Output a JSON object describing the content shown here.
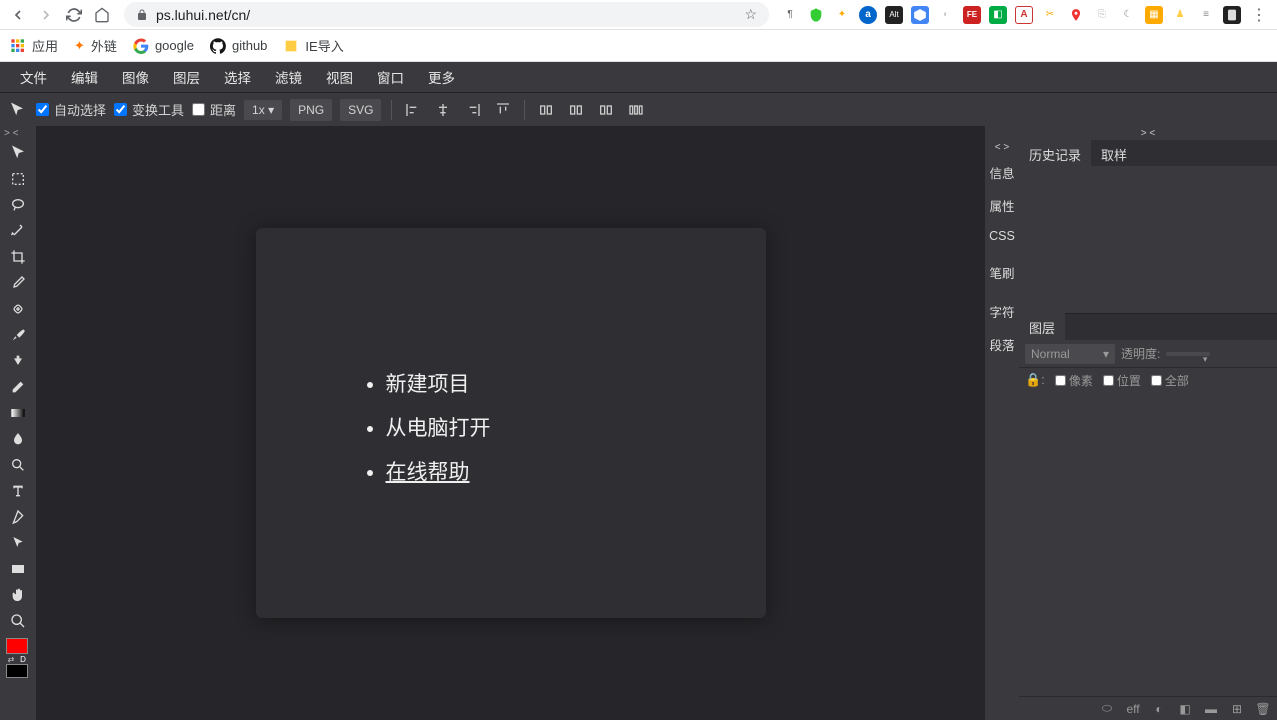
{
  "browser": {
    "url": "ps.luhui.net/cn/",
    "bookmarks": {
      "apps": "应用",
      "external": "外链",
      "google": "google",
      "github": "github",
      "ie_import": "IE导入"
    }
  },
  "menu": {
    "file": "文件",
    "edit": "编辑",
    "image": "图像",
    "layer": "图层",
    "select": "选择",
    "filter": "滤镜",
    "view": "视图",
    "window": "窗口",
    "more": "更多"
  },
  "options": {
    "auto_select": "自动选择",
    "transform": "变换工具",
    "distance": "距离",
    "zoom": "1x",
    "png": "PNG",
    "svg": "SVG"
  },
  "welcome": {
    "new_project": "新建项目",
    "open_from_computer": "从电脑打开",
    "online_help": "在线帮助"
  },
  "side_tabs": {
    "info": "信息",
    "properties": "属性",
    "css": "CSS",
    "brush": "笔刷",
    "character": "字符",
    "paragraph": "段落"
  },
  "panel_tabs": {
    "history": "历史记录",
    "sample": "取样"
  },
  "layers": {
    "title": "图层",
    "blend": "Normal",
    "opacity_label": "透明度:",
    "opacity_value": "",
    "lock_pixel": "像素",
    "lock_position": "位置",
    "lock_all": "全部"
  },
  "footer": {
    "eff": "eff"
  },
  "colors": {
    "foreground": "#ff0000",
    "background": "#000000"
  }
}
